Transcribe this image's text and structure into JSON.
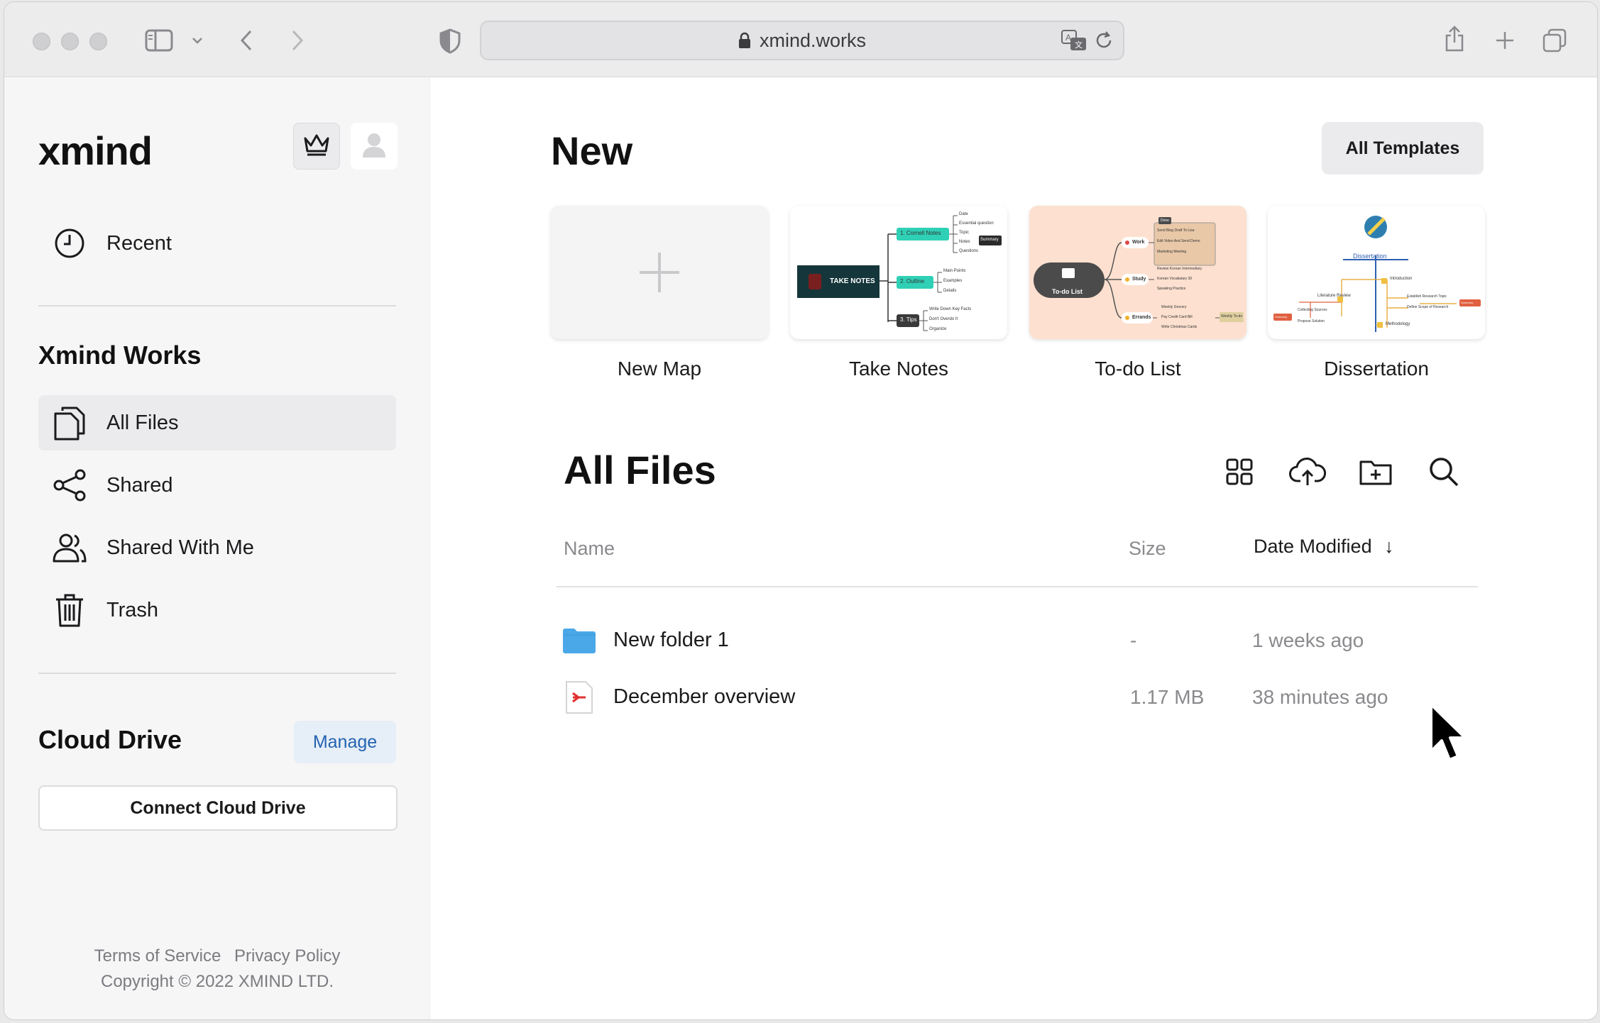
{
  "browser": {
    "url": "xmind.works"
  },
  "sidebar": {
    "logo": "xmind",
    "nav_top": [
      {
        "label": "Recent",
        "icon": "clock-icon"
      }
    ],
    "workspace_title": "Xmind Works",
    "nav": [
      {
        "label": "All Files",
        "icon": "files-icon",
        "active": true
      },
      {
        "label": "Shared",
        "icon": "share-icon"
      },
      {
        "label": "Shared With Me",
        "icon": "users-icon"
      },
      {
        "label": "Trash",
        "icon": "trash-icon"
      }
    ],
    "cloud_title": "Cloud Drive",
    "manage_label": "Manage",
    "connect_label": "Connect Cloud Drive",
    "footer": {
      "terms": "Terms of Service",
      "privacy": "Privacy Policy",
      "copyright": "Copyright © 2022 XMIND LTD."
    }
  },
  "main": {
    "new_title": "New",
    "all_templates_label": "All Templates",
    "templates": [
      {
        "label": "New Map"
      },
      {
        "label": "Take Notes"
      },
      {
        "label": "To-do List"
      },
      {
        "label": "Dissertation"
      }
    ],
    "files_title": "All Files",
    "columns": {
      "name": "Name",
      "size": "Size",
      "date": "Date Modified",
      "sort_arrow": "↓"
    },
    "files": [
      {
        "name": "New folder 1",
        "size": "-",
        "date": "1 weeks ago",
        "type": "folder"
      },
      {
        "name": "December overview",
        "size": "1.17 MB",
        "date": "38 minutes ago",
        "type": "xmind-file"
      }
    ]
  },
  "thumbs": {
    "take_notes": {
      "root": "TAKE NOTES",
      "b1": "1. Cornell Notes",
      "b2": "2. Outline",
      "b3": "3. Tips",
      "summary": "Summary",
      "l1": [
        "Date",
        "Essential question",
        "Topic",
        "Notes",
        "Questions"
      ],
      "l2": [
        "Main Points",
        "Examples",
        "Details"
      ],
      "l3": [
        "Write Down Key Facts",
        "Don't Overdo It",
        "Organize"
      ]
    },
    "todo": {
      "root": "To-do List",
      "b1": "Work",
      "b2": "Study",
      "b3": "Errands",
      "tag1": "Done",
      "tag2": "Weekly To-do",
      "l1": [
        "Send Blog Draft To Lisa",
        "Edit Video And Send Demo",
        "Marketing Meeting"
      ],
      "l2": [
        "Review Korean Intermediary",
        "Korean Vocabulary 30",
        "Speaking Practice"
      ],
      "l3": [
        "Weekly Grocery",
        "Pay Credit Card Bill",
        "Write Christmas Cards"
      ]
    },
    "dissertation": {
      "root": "Dissertation",
      "b1": "Introduction",
      "b2": "Literature Review",
      "b3": "Methodology",
      "l1": [
        "Establish Research Topic",
        "Define Scope of Research"
      ],
      "l2": [
        "Collecting Sources",
        "Propose Solution"
      ],
      "tag1": "Summary",
      "tag2": "Summary"
    }
  },
  "colors": {
    "accent_blue": "#2463b0",
    "folder_blue": "#4aa8e8",
    "teal": "#2fd0b5",
    "dark_root": "#15363a",
    "todo_bg": "#fde0cf"
  }
}
